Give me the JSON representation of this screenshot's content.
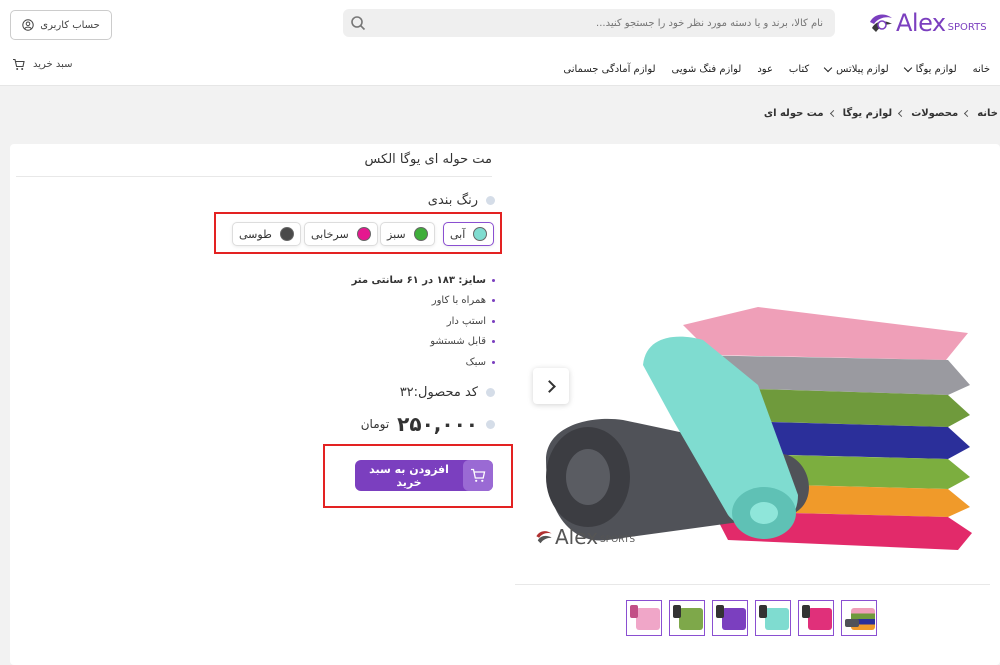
{
  "header": {
    "brand": "Alex",
    "brand_sub": "SPORTS",
    "search_placeholder": "نام کالا، برند و یا دسته مورد نظر خود را جستجو کنید...",
    "account_label": "حساب کاربری",
    "cart_label": "سبد خرید"
  },
  "nav": [
    {
      "label": "خانه",
      "has_dropdown": false
    },
    {
      "label": "لوازم یوگا",
      "has_dropdown": true
    },
    {
      "label": "لوازم پیلاتس",
      "has_dropdown": true
    },
    {
      "label": "کتاب",
      "has_dropdown": false
    },
    {
      "label": "عود",
      "has_dropdown": false
    },
    {
      "label": "لوازم فنگ شویی",
      "has_dropdown": false
    },
    {
      "label": "لوازم آمادگی جسمانی",
      "has_dropdown": false
    }
  ],
  "breadcrumb": [
    "خانه",
    "محصولات",
    "لوازم یوگا",
    "مت حوله ای"
  ],
  "product": {
    "title": "مت حوله ای یوگا الکس",
    "color_heading": "رنگ بندی",
    "colors": [
      {
        "label": "آبی",
        "hex": "#7fdcd0",
        "selected": true
      },
      {
        "label": "سبز",
        "hex": "#3fae3a",
        "selected": false
      },
      {
        "label": "سرخابی",
        "hex": "#e5178f",
        "selected": false
      },
      {
        "label": "طوسی",
        "hex": "#4a4a4a",
        "selected": false
      }
    ],
    "features": [
      "سایز: ۱۸۳ در ۶۱ سانتی متر",
      "همراه با کاور",
      "استپ دار",
      "قابل شستشو",
      "سبک"
    ],
    "code": "کد محصول:۳۲",
    "price": "۲۵۰,۰۰۰",
    "currency": "تومان",
    "add_to_cart": "افزودن به سبد خرید"
  },
  "gallery": {
    "watermark": "Alex",
    "watermark_sub": "SPORTS",
    "thumbnails": [
      {
        "name": "pink",
        "hex": "#f0a6c8"
      },
      {
        "name": "green",
        "hex": "#7ea84a"
      },
      {
        "name": "purple",
        "hex": "#7b3fbf"
      },
      {
        "name": "teal",
        "hex": "#7fdcd0"
      },
      {
        "name": "magenta",
        "hex": "#e0307a"
      },
      {
        "name": "stack",
        "hex": "#4a7fc0"
      }
    ]
  },
  "colors": {
    "accent": "#7b3fbf",
    "highlight": "#e32222"
  }
}
